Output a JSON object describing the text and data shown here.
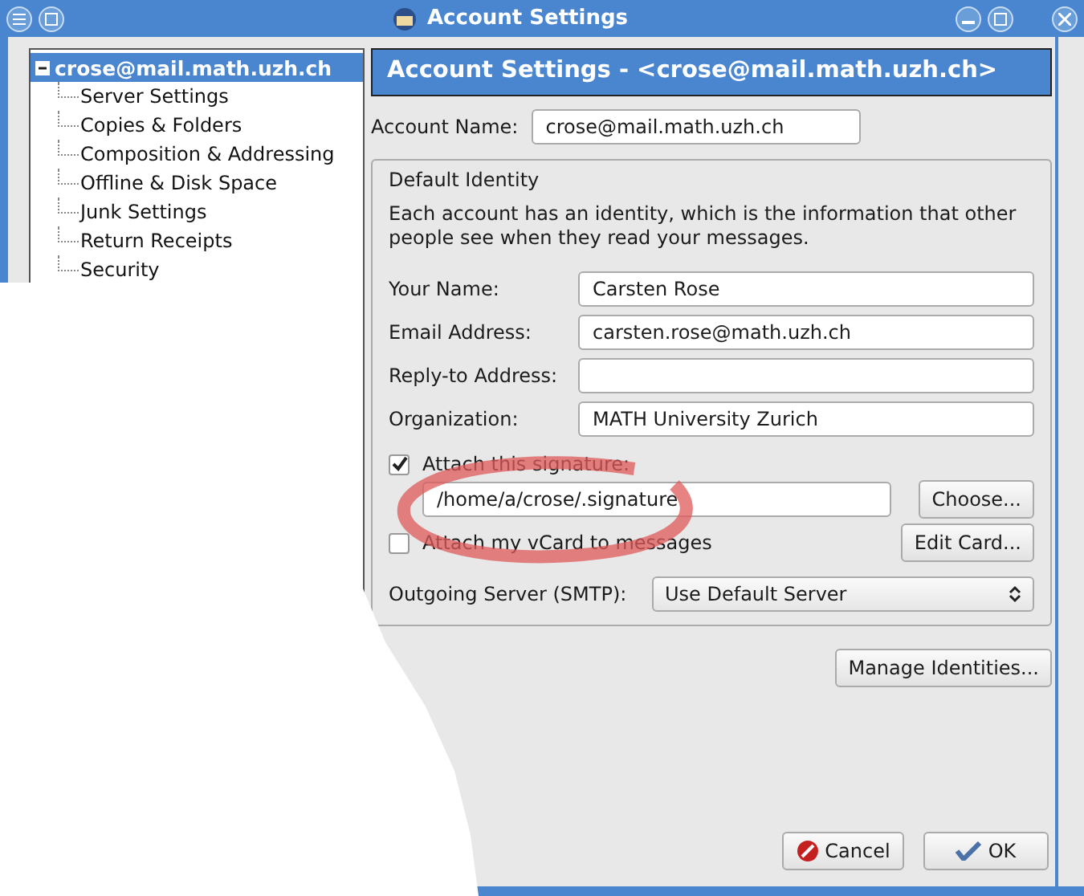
{
  "window": {
    "title": "Account Settings"
  },
  "tree": {
    "label": "crose@mail.math.uzh.ch",
    "expanded": true,
    "selected": true,
    "children": [
      {
        "label": "Server Settings",
        "selected": false
      },
      {
        "label": "Copies & Folders",
        "selected": false
      },
      {
        "label": "Composition & Addressing",
        "selected": false
      },
      {
        "label": "Offline & Disk Space",
        "selected": false
      },
      {
        "label": "Junk Settings",
        "selected": false
      },
      {
        "label": "Return Receipts",
        "selected": false
      },
      {
        "label": "Security",
        "selected": false
      }
    ]
  },
  "header": "Account Settings - <crose@mail.math.uzh.ch>",
  "account_name": {
    "label": "Account Name:",
    "value": "crose@mail.math.uzh.ch"
  },
  "identity": {
    "legend": "Default Identity",
    "description": "Each account has an identity, which is the information that other people see when they read your messages.",
    "fields": [
      {
        "label": "Your Name:",
        "value": "Carsten  Rose"
      },
      {
        "label": "Email Address:",
        "value": "carsten.rose@math.uzh.ch"
      },
      {
        "label": "Reply-to Address:"
      },
      {
        "label": "Organization:",
        "value": "MATH University Zurich"
      }
    ],
    "signature": {
      "label": "Attach this signature:",
      "checked": true,
      "path": "/home/a/crose/.signature",
      "button": "Choose..."
    },
    "vcard": {
      "label": "Attach my vCard to messages",
      "checked": false,
      "button": "Edit Card..."
    },
    "outgoing": {
      "label": "Outgoing Server (SMTP):",
      "value": "Use Default Server"
    }
  },
  "manage_button": "Manage Identities...",
  "buttons": [
    {
      "label": "Cancel",
      "kind": "cancel"
    },
    {
      "label": "OK",
      "kind": "ok"
    }
  ]
}
